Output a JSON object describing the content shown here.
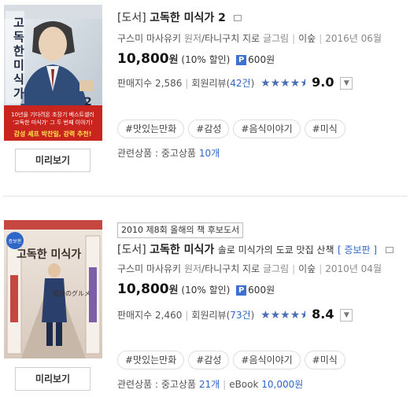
{
  "items": [
    {
      "category": "[도서]",
      "title": "고독한 미식가 2",
      "subtitle": "",
      "edition": "",
      "award": "",
      "author": "구스미 마사유키",
      "author_role": "원저",
      "illustrator": "타니구치 지로",
      "illustrator_role": "글그림",
      "publisher": "이숲",
      "date": "2016년 06월",
      "price": "10,800",
      "won": "원",
      "discount": "(10% 할인)",
      "point_badge": "P",
      "points": "600원",
      "sales_label": "판매지수",
      "sales_value": "2,586",
      "review_label": "회원리뷰(",
      "review_count": "42건",
      "review_close": ")",
      "rating": 4.5,
      "score": "9.0",
      "tags": [
        "#맛있는만화",
        "#감성",
        "#음식이야기",
        "#미식"
      ],
      "related_label": "관련상품 : 중고상품",
      "related_count": "10개",
      "ebook_label": "",
      "ebook_price": "",
      "preview_label": "미리보기",
      "cover_text": {
        "title_vertical": "고독한 미식가",
        "num": "2",
        "blurb": "10년을 기다려온 초장기 베스트셀러 '고독한 미식가' 그 두 번째 이야기!",
        "promo": "감성 셰프 박찬일, 강력 추천!"
      }
    },
    {
      "category": "[도서]",
      "title": "고독한 미식가",
      "subtitle": "솔로 미식가의 도쿄 맛집 산책",
      "edition": "[ 증보판 ]",
      "award": "2010 제8회 올해의 책 후보도서",
      "author": "구스미 마사유키",
      "author_role": "원저",
      "illustrator": "타니구치 지로",
      "illustrator_role": "글그림",
      "publisher": "이숲",
      "date": "2010년 04월",
      "price": "10,800",
      "won": "원",
      "discount": "(10% 할인)",
      "point_badge": "P",
      "points": "600원",
      "sales_label": "판매지수",
      "sales_value": "2,460",
      "review_label": "회원리뷰(",
      "review_count": "73건",
      "review_close": ")",
      "rating": 4.5,
      "score": "8.4",
      "tags": [
        "#맛있는만화",
        "#감성",
        "#음식이야기",
        "#미식"
      ],
      "related_label": "관련상품 : 중고상품",
      "related_count": "21개",
      "ebook_label": "eBook",
      "ebook_price": "10,000원",
      "preview_label": "미리보기",
      "cover_text": {
        "title_vertical": "고독한 미식가",
        "subtitle": "孤独のグルメ",
        "badge": "증보판"
      }
    }
  ],
  "colors": {
    "accent": "#2f67c8",
    "star": "#4a6fb5",
    "promo_red": "#c9241e"
  }
}
